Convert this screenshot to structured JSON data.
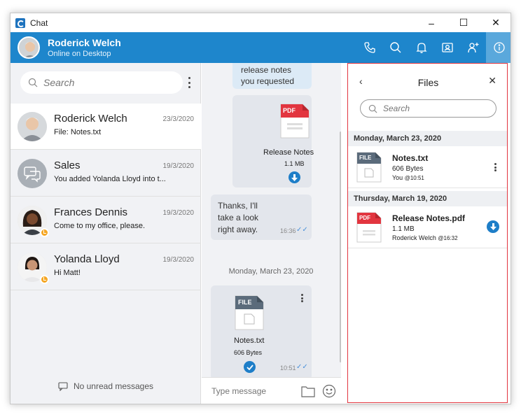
{
  "window": {
    "title": "Chat",
    "controls": [
      "–",
      "☐",
      "✕"
    ]
  },
  "header": {
    "name": "Roderick Welch",
    "status": "Online on Desktop"
  },
  "left": {
    "search_placeholder": "Search",
    "conversations": [
      {
        "name": "Roderick Welch",
        "date": "23/3/2020",
        "preview": "File: Notes.txt"
      },
      {
        "name": "Sales",
        "date": "19/3/2020",
        "preview": "You added Yolanda Lloyd into t..."
      },
      {
        "name": "Frances Dennis",
        "date": "19/3/2020",
        "preview": "Come to my office, please."
      },
      {
        "name": "Yolanda Lloyd",
        "date": "19/3/2020",
        "preview": "Hi Matt!"
      }
    ],
    "no_unread": "No unread messages"
  },
  "chat": {
    "msg1_line1": "release notes",
    "msg1_line2": "you requested",
    "file1_badge": "PDF",
    "file1_name": "Release Notes",
    "file1_size": "1.1 MB",
    "msg2_line1": "Thanks, I'll",
    "msg2_line2": "take a look",
    "msg2_line3": "right away.",
    "msg2_time": "16:36",
    "date_sep": "Monday, March 23, 2020",
    "file2_badge": "FILE",
    "file2_name": "Notes.txt",
    "file2_size": "606 Bytes",
    "file2_time": "10:51",
    "composer_placeholder": "Type message"
  },
  "files": {
    "title": "Files",
    "search_placeholder": "Search",
    "groups": [
      {
        "date": "Monday, March 23, 2020",
        "badge": "FILE",
        "name": "Notes.txt",
        "size": "606 Bytes",
        "by": "You",
        "time": "@10:51"
      },
      {
        "date": "Thursday, March 19, 2020",
        "badge": "PDF",
        "name": "Release Notes.pdf",
        "size": "1.1 MB",
        "by": "Roderick Welch",
        "time": "@16:32"
      }
    ]
  },
  "colors": {
    "accent": "#1e86cc",
    "highlight_border": "#e2353f",
    "pdf": "#e2353f",
    "file": "#5b6b7b"
  }
}
